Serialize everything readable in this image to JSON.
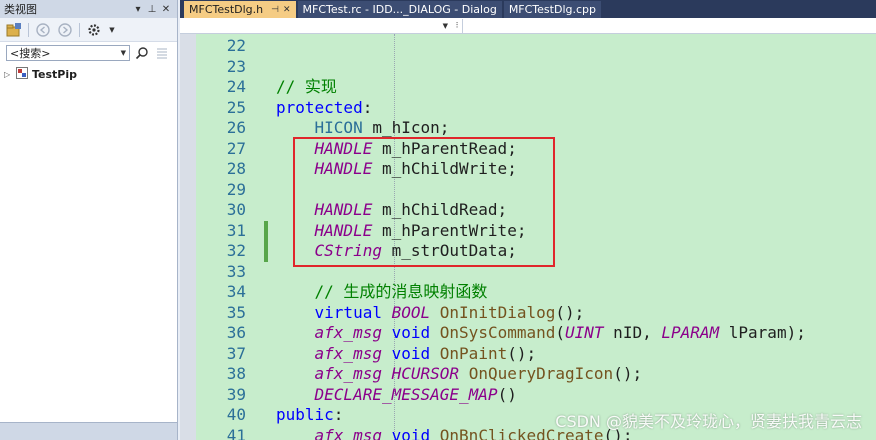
{
  "class_view": {
    "title": "类视图",
    "title_buttons": [
      "▾",
      "⊥",
      "✕"
    ],
    "search_placeholder": "<搜索>",
    "tree": [
      {
        "label": "TestPip",
        "expanded": false
      }
    ]
  },
  "tabs": [
    {
      "label": "MFCTestDlg.h",
      "active": true,
      "icons": [
        "⊣",
        "✕"
      ]
    },
    {
      "label": "MFCTest.rc - IDD..._DIALOG - Dialog",
      "active": false
    },
    {
      "label": "MFCTestDlg.cpp",
      "active": false
    }
  ],
  "code": {
    "lines": [
      {
        "num": "22",
        "tokens": []
      },
      {
        "num": "23",
        "tokens": []
      },
      {
        "num": "24",
        "tokens": [
          {
            "t": "// 实现",
            "c": "cm"
          }
        ]
      },
      {
        "num": "25",
        "tokens": [
          {
            "t": "protected",
            "c": "kw"
          },
          {
            "t": ":",
            "c": "pu"
          }
        ]
      },
      {
        "num": "26",
        "tokens": [
          {
            "t": "    ",
            "c": "pu"
          },
          {
            "t": "HICON",
            "c": "ty"
          },
          {
            "t": " m_hIcon;",
            "c": "mem"
          }
        ]
      },
      {
        "num": "27",
        "tokens": [
          {
            "t": "    ",
            "c": "pu"
          },
          {
            "t": "HANDLE",
            "c": "mac"
          },
          {
            "t": " m_hParentRead;",
            "c": "mem"
          }
        ]
      },
      {
        "num": "28",
        "tokens": [
          {
            "t": "    ",
            "c": "pu"
          },
          {
            "t": "HANDLE",
            "c": "mac"
          },
          {
            "t": " m_hChildWrite;",
            "c": "mem"
          }
        ]
      },
      {
        "num": "29",
        "tokens": []
      },
      {
        "num": "30",
        "tokens": [
          {
            "t": "    ",
            "c": "pu"
          },
          {
            "t": "HANDLE",
            "c": "mac"
          },
          {
            "t": " m_hChildRead;",
            "c": "mem"
          }
        ]
      },
      {
        "num": "31",
        "tokens": [
          {
            "t": "    ",
            "c": "pu"
          },
          {
            "t": "HANDLE",
            "c": "mac"
          },
          {
            "t": " m_hParentWrite;",
            "c": "mem"
          }
        ]
      },
      {
        "num": "32",
        "tokens": [
          {
            "t": "    ",
            "c": "pu"
          },
          {
            "t": "CString",
            "c": "mac"
          },
          {
            "t": " m_strOutData;",
            "c": "mem"
          }
        ]
      },
      {
        "num": "33",
        "tokens": []
      },
      {
        "num": "34",
        "tokens": [
          {
            "t": "    ",
            "c": "pu"
          },
          {
            "t": "// 生成的消息映射函数",
            "c": "cm"
          }
        ]
      },
      {
        "num": "35",
        "tokens": [
          {
            "t": "    ",
            "c": "pu"
          },
          {
            "t": "virtual",
            "c": "kw"
          },
          {
            "t": " ",
            "c": "pu"
          },
          {
            "t": "BOOL",
            "c": "mac"
          },
          {
            "t": " ",
            "c": "pu"
          },
          {
            "t": "OnInitDialog",
            "c": "fn"
          },
          {
            "t": "();",
            "c": "pu"
          }
        ]
      },
      {
        "num": "36",
        "tokens": [
          {
            "t": "    ",
            "c": "pu"
          },
          {
            "t": "afx_msg",
            "c": "mac"
          },
          {
            "t": " ",
            "c": "pu"
          },
          {
            "t": "void",
            "c": "kw"
          },
          {
            "t": " ",
            "c": "pu"
          },
          {
            "t": "OnSysCommand",
            "c": "fn"
          },
          {
            "t": "(",
            "c": "pu"
          },
          {
            "t": "UINT",
            "c": "mac"
          },
          {
            "t": " nID, ",
            "c": "var"
          },
          {
            "t": "LPARAM",
            "c": "mac"
          },
          {
            "t": " lParam);",
            "c": "var"
          }
        ]
      },
      {
        "num": "37",
        "tokens": [
          {
            "t": "    ",
            "c": "pu"
          },
          {
            "t": "afx_msg",
            "c": "mac"
          },
          {
            "t": " ",
            "c": "pu"
          },
          {
            "t": "void",
            "c": "kw"
          },
          {
            "t": " ",
            "c": "pu"
          },
          {
            "t": "OnPaint",
            "c": "fn"
          },
          {
            "t": "();",
            "c": "pu"
          }
        ]
      },
      {
        "num": "38",
        "tokens": [
          {
            "t": "    ",
            "c": "pu"
          },
          {
            "t": "afx_msg",
            "c": "mac"
          },
          {
            "t": " ",
            "c": "pu"
          },
          {
            "t": "HCURSOR",
            "c": "mac"
          },
          {
            "t": " ",
            "c": "pu"
          },
          {
            "t": "OnQueryDragIcon",
            "c": "fn"
          },
          {
            "t": "();",
            "c": "pu"
          }
        ]
      },
      {
        "num": "39",
        "tokens": [
          {
            "t": "    ",
            "c": "pu"
          },
          {
            "t": "DECLARE_MESSAGE_MAP",
            "c": "mac"
          },
          {
            "t": "()",
            "c": "pu"
          }
        ]
      },
      {
        "num": "40",
        "tokens": [
          {
            "t": "public",
            "c": "kw"
          },
          {
            "t": ":",
            "c": "pu"
          }
        ]
      },
      {
        "num": "41",
        "tokens": [
          {
            "t": "    ",
            "c": "pu"
          },
          {
            "t": "afx_msg",
            "c": "mac"
          },
          {
            "t": " ",
            "c": "pu"
          },
          {
            "t": "void",
            "c": "kw"
          },
          {
            "t": " ",
            "c": "pu"
          },
          {
            "t": "OnBnClickedCreate",
            "c": "fn"
          },
          {
            "t": "();",
            "c": "pu"
          }
        ]
      }
    ],
    "changed_lines": [
      "31",
      "32"
    ]
  },
  "watermark": "CSDN @貌美不及玲珑心，贤妻扶我青云志",
  "colors": {
    "editor_bg": "#c7edcc",
    "highlight_box": "#e0262b",
    "active_tab": "#f5cc84",
    "tab_bar": "#2b3a5c"
  }
}
